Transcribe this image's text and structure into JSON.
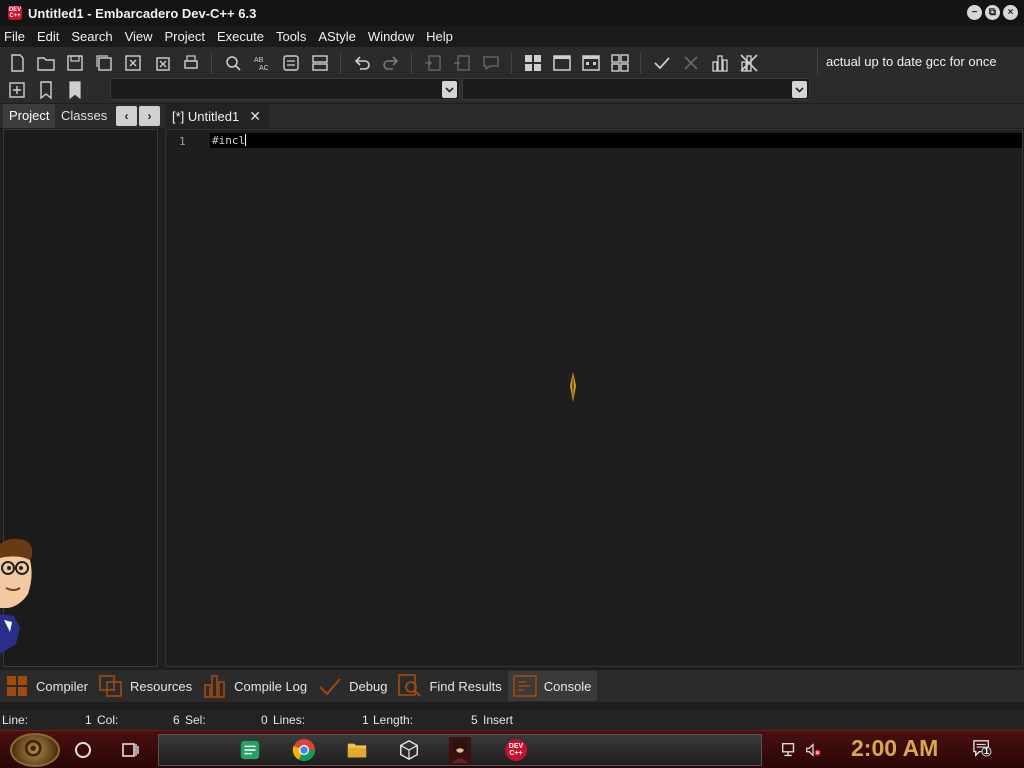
{
  "window": {
    "title": "Untitled1 - Embarcadero Dev-C++ 6.3",
    "logo_text": "DEV C++",
    "controls": [
      "−",
      "⧉",
      "×"
    ]
  },
  "menu": [
    "File",
    "Edit",
    "Search",
    "View",
    "Project",
    "Execute",
    "Tools",
    "AStyle",
    "Window",
    "Help"
  ],
  "toolbar": {
    "message": "actual up to date gcc for once"
  },
  "left_panel": {
    "tabs": [
      "Project",
      "Classes"
    ],
    "prev": "‹",
    "next": "›"
  },
  "editor": {
    "tab_label": "[*] Untitled1",
    "tab_close": "✕",
    "line_number": "1",
    "code": "#incl"
  },
  "bottom_tabs": [
    "Compiler",
    "Resources",
    "Compile Log",
    "Debug",
    "Find Results",
    "Console"
  ],
  "status": {
    "line_label": "Line:",
    "line_value": "1",
    "col_label": "Col:",
    "col_value": "6",
    "sel_label": "Sel:",
    "sel_value": "0",
    "lines_label": "Lines:",
    "lines_value": "1",
    "length_label": "Length:",
    "length_value": "5",
    "mode": "Insert"
  },
  "taskbar": {
    "clock": "2:00 AM",
    "dev_icon_text": "DEV C++",
    "notif_count": "1"
  },
  "colors": {
    "accent": "#c8102e",
    "clock": "#d9a84a"
  }
}
